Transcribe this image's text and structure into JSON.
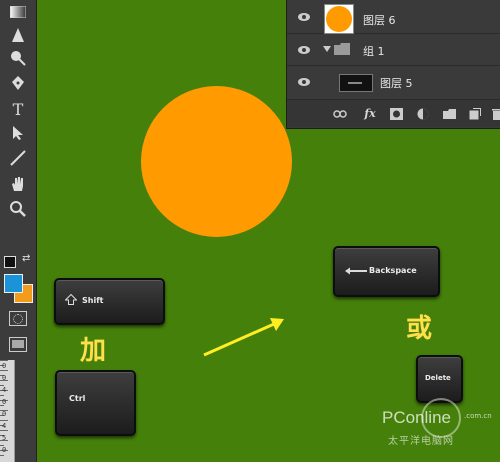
{
  "toolbar": {
    "tools": [
      "gradient-tool",
      "blur-tool",
      "dodge-tool",
      "pen-tool",
      "type-tool",
      "path-selection-tool",
      "line-tool",
      "hand-tool",
      "zoom-tool"
    ],
    "type_tool_glyph": "T",
    "foreground_color": "#1a93d8",
    "background_color": "#f39c1b"
  },
  "ruler": {
    "numbers": [
      "0",
      "0",
      "4",
      "0",
      "0",
      "4",
      "5",
      "0"
    ]
  },
  "canvas": {
    "background": "#45800b",
    "circle_color": "#ff9b00"
  },
  "layers_panel": {
    "layers": [
      {
        "name": "图层 6"
      },
      {
        "name": "组 1"
      },
      {
        "name": "图层 5"
      }
    ],
    "footer_icons": [
      "link-icon",
      "fx-icon",
      "mask-icon",
      "adjustment-icon",
      "folder-icon",
      "new-layer-icon",
      "trash-icon"
    ],
    "fx_label": "fx"
  },
  "keys": {
    "shift": "Shift",
    "ctrl": "Ctrl",
    "backspace": "Backspace",
    "delete": "Delete"
  },
  "texts": {
    "plus": "加",
    "or": "或"
  },
  "watermark": {
    "logo": "PConline",
    "domain": ".com.cn",
    "subtitle": "太平洋电脑网"
  }
}
